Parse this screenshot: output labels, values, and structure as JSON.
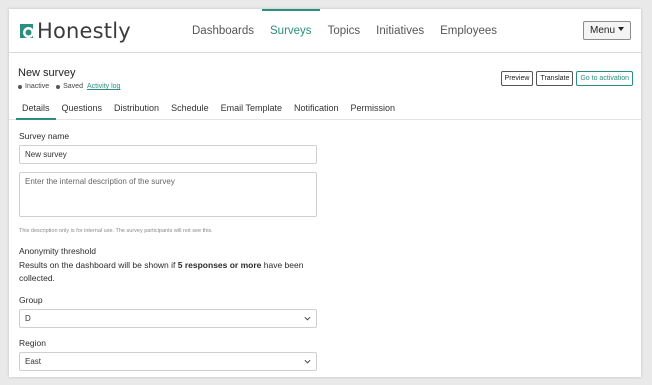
{
  "brand": {
    "name": "Honestly",
    "logo_color": "#2a8f7e"
  },
  "nav": {
    "items": [
      {
        "label": "Dashboards",
        "active": false
      },
      {
        "label": "Surveys",
        "active": true
      },
      {
        "label": "Topics",
        "active": false
      },
      {
        "label": "Initiatives",
        "active": false
      },
      {
        "label": "Employees",
        "active": false
      }
    ],
    "menu_label": "Menu"
  },
  "survey": {
    "title": "New survey",
    "status": "Inactive",
    "save_state": "Saved",
    "activity_log": "Activity log",
    "actions": {
      "preview": "Preview",
      "translate": "Translate",
      "activate": "Go to activation"
    }
  },
  "tabs": [
    {
      "label": "Details",
      "active": true
    },
    {
      "label": "Questions",
      "active": false
    },
    {
      "label": "Distribution",
      "active": false
    },
    {
      "label": "Schedule",
      "active": false
    },
    {
      "label": "Email Template",
      "active": false
    },
    {
      "label": "Notification",
      "active": false
    },
    {
      "label": "Permission",
      "active": false
    }
  ],
  "form": {
    "name_label": "Survey name",
    "name_value": "New survey",
    "description_placeholder": "Enter the internal description of the survey",
    "description_hint": "This description only is for internal use. The survey participants will not see this.",
    "anonymity_label": "Anonymity threshold",
    "anonymity_text_before": "Results on the dashboard will be shown if ",
    "anonymity_bold": "5 responses or more",
    "anonymity_text_after": " have been collected.",
    "group_label": "Group",
    "group_value": "D",
    "region_label": "Region",
    "region_value": "East"
  },
  "colors": {
    "accent": "#2a8f7e",
    "background": "#e9e9e9"
  }
}
